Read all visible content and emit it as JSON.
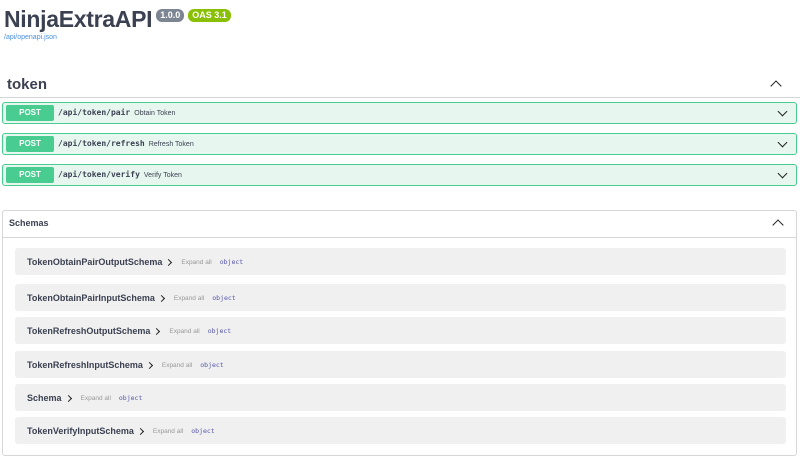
{
  "info": {
    "title": "NinjaExtraAPI",
    "version": "1.0.0",
    "oas_version": "OAS 3.1",
    "spec_url": "/api/openapi.json"
  },
  "tag": {
    "name": "token",
    "operations": [
      {
        "method": "POST",
        "path": "/api/token/pair",
        "summary": "Obtain Token"
      },
      {
        "method": "POST",
        "path": "/api/token/refresh",
        "summary": "Refresh Token"
      },
      {
        "method": "POST",
        "path": "/api/token/verify",
        "summary": "Verify Token"
      }
    ]
  },
  "schemas": {
    "title": "Schemas",
    "models": [
      {
        "name": "TokenObtainPairOutputSchema",
        "expand": "Expand all",
        "type": "object"
      },
      {
        "name": "TokenObtainPairInputSchema",
        "expand": "Expand all",
        "type": "object"
      },
      {
        "name": "TokenRefreshOutputSchema",
        "expand": "Expand all",
        "type": "object"
      },
      {
        "name": "TokenRefreshInputSchema",
        "expand": "Expand all",
        "type": "object"
      },
      {
        "name": "Schema",
        "expand": "Expand all",
        "type": "object"
      },
      {
        "name": "TokenVerifyInputSchema",
        "expand": "Expand all",
        "type": "object"
      }
    ]
  },
  "colors": {
    "post_method": "#49cc90",
    "post_background": "#e8f6f0",
    "version_badge": "#7d8492",
    "oas_badge": "#89bf04",
    "link": "#4990e2"
  },
  "icons": {
    "collapse": "chevron-up-icon",
    "expand": "chevron-down-icon",
    "model_toggle": "chevron-right-icon"
  }
}
